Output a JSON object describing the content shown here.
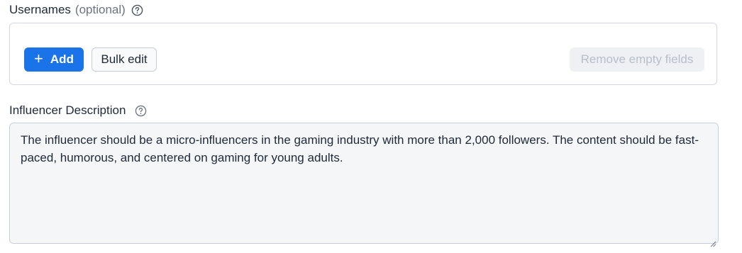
{
  "usernames": {
    "label": "Usernames",
    "optional_text": "(optional)",
    "add_button_label": "Add",
    "add_button_icon": "plus-icon",
    "bulk_edit_label": "Bulk edit",
    "remove_empty_label": "Remove empty fields",
    "remove_empty_enabled": false
  },
  "description": {
    "label": "Influencer Description",
    "value": "The influencer should be a micro-influencers in the gaming industry with more than 2,000 followers. The content should be fast-paced, humorous, and centered on gaming for young adults."
  },
  "colors": {
    "primary": "#1a73e8",
    "text": "#1f2937",
    "muted": "#6b7280",
    "disabled_text": "#b8bfca",
    "input_bg": "#f5f6f8"
  },
  "icons": {
    "help": "question-circle-icon",
    "add": "plus-icon",
    "resize": "resize-handle-icon"
  }
}
